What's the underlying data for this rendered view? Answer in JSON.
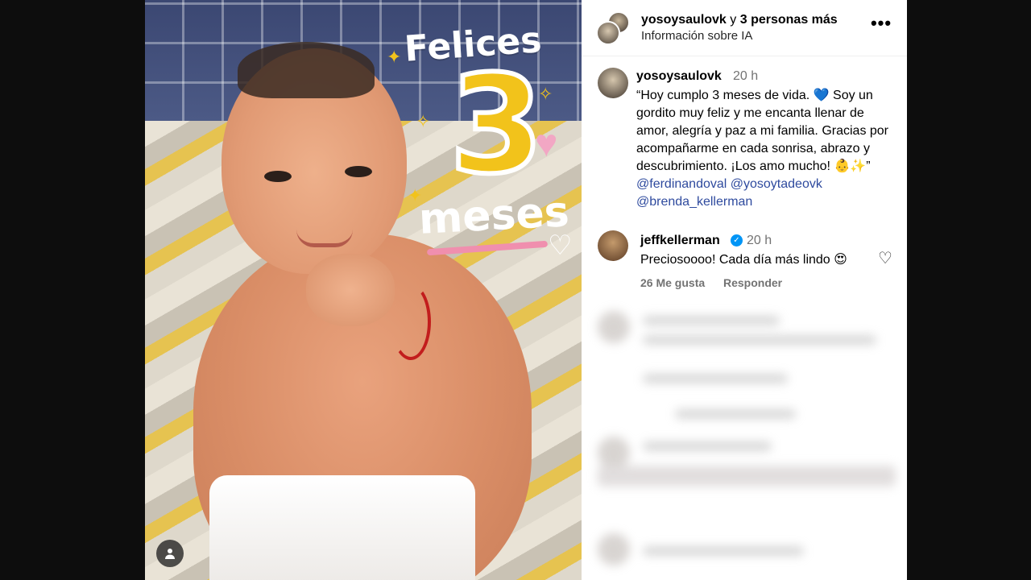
{
  "post": {
    "overlay": {
      "line1": "Felices",
      "number": "3",
      "line2": "meses"
    }
  },
  "header": {
    "author": "yosoysaulovk",
    "joiner": "y",
    "others": "3 personas más",
    "subtitle": "Información sobre IA",
    "more_label": "•••"
  },
  "caption": {
    "user": "yosoysaulovk",
    "time": "20 h",
    "text": "“Hoy cumplo 3 meses de vida. 💙 Soy un gordito muy feliz y me encanta llenar de amor, alegría y paz a mi familia. Gracias por acompañarme en cada sonrisa, abrazo y descubrimiento. ¡Los amo mucho! 👶✨”",
    "mentions": [
      "@ferdinandoval",
      "@yosoytadeovk",
      "@brenda_kellerman"
    ]
  },
  "comment": {
    "user": "jeffkellerman",
    "time": "20 h",
    "text": "Preciosoooo! Cada día más lindo 😍",
    "likes": "26 Me gusta",
    "reply_label": "Responder"
  },
  "icons": {
    "more": "more-horizontal-icon",
    "verified": "verified-badge-icon",
    "like": "heart-outline-icon",
    "tag": "user-tag-icon"
  },
  "colors": {
    "mention": "#2e4a9e",
    "verified": "#0095f6",
    "overlay_yellow": "#f2c31b",
    "overlay_pink": "#f2a7c4"
  }
}
